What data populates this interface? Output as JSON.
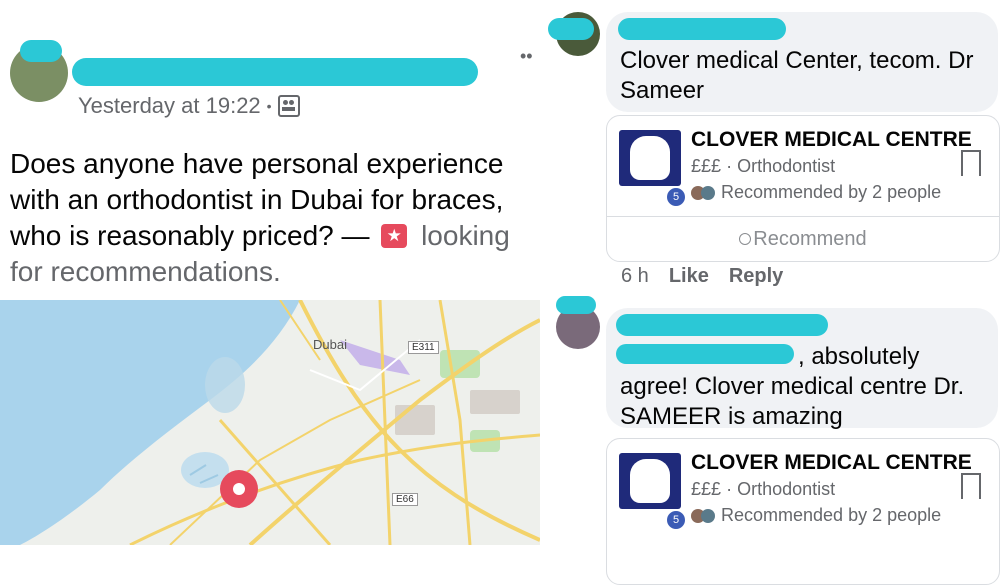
{
  "post": {
    "timestamp": "Yesterday at 19:22",
    "separator": "•",
    "privacy_icon": "group-icon",
    "text_main": "Does anyone have personal experience with an orthodontist in Dubai for braces, who is reasonably priced? —",
    "badge_icon": "star-icon",
    "text_feeling": "looking for recommendations.",
    "more_glyph": "••"
  },
  "map": {
    "city_label": "Dubai",
    "road_e311": "E311",
    "road_e66": "E66",
    "colors": {
      "water": "#a9d3ec",
      "land": "#eef0ec",
      "park": "#bfe3b4",
      "road": "#f3d36b",
      "pin": "#e64a5d"
    }
  },
  "comment1": {
    "text": "Clover medical Center, tecom. Dr Sameer",
    "time": "6 h",
    "like_label": "Like",
    "reply_label": "Reply"
  },
  "comment2": {
    "text_suffix": ", absolutely agree! Clover medical centre Dr. SAMEER is amazing"
  },
  "place_card": {
    "name": "CLOVER MEDICAL CENTRE",
    "price": "£££",
    "dot": "·",
    "category": "Orthodontist",
    "recommended": "Recommended by 2 people",
    "badge_count": "5",
    "recommend_label": "Recommend"
  }
}
